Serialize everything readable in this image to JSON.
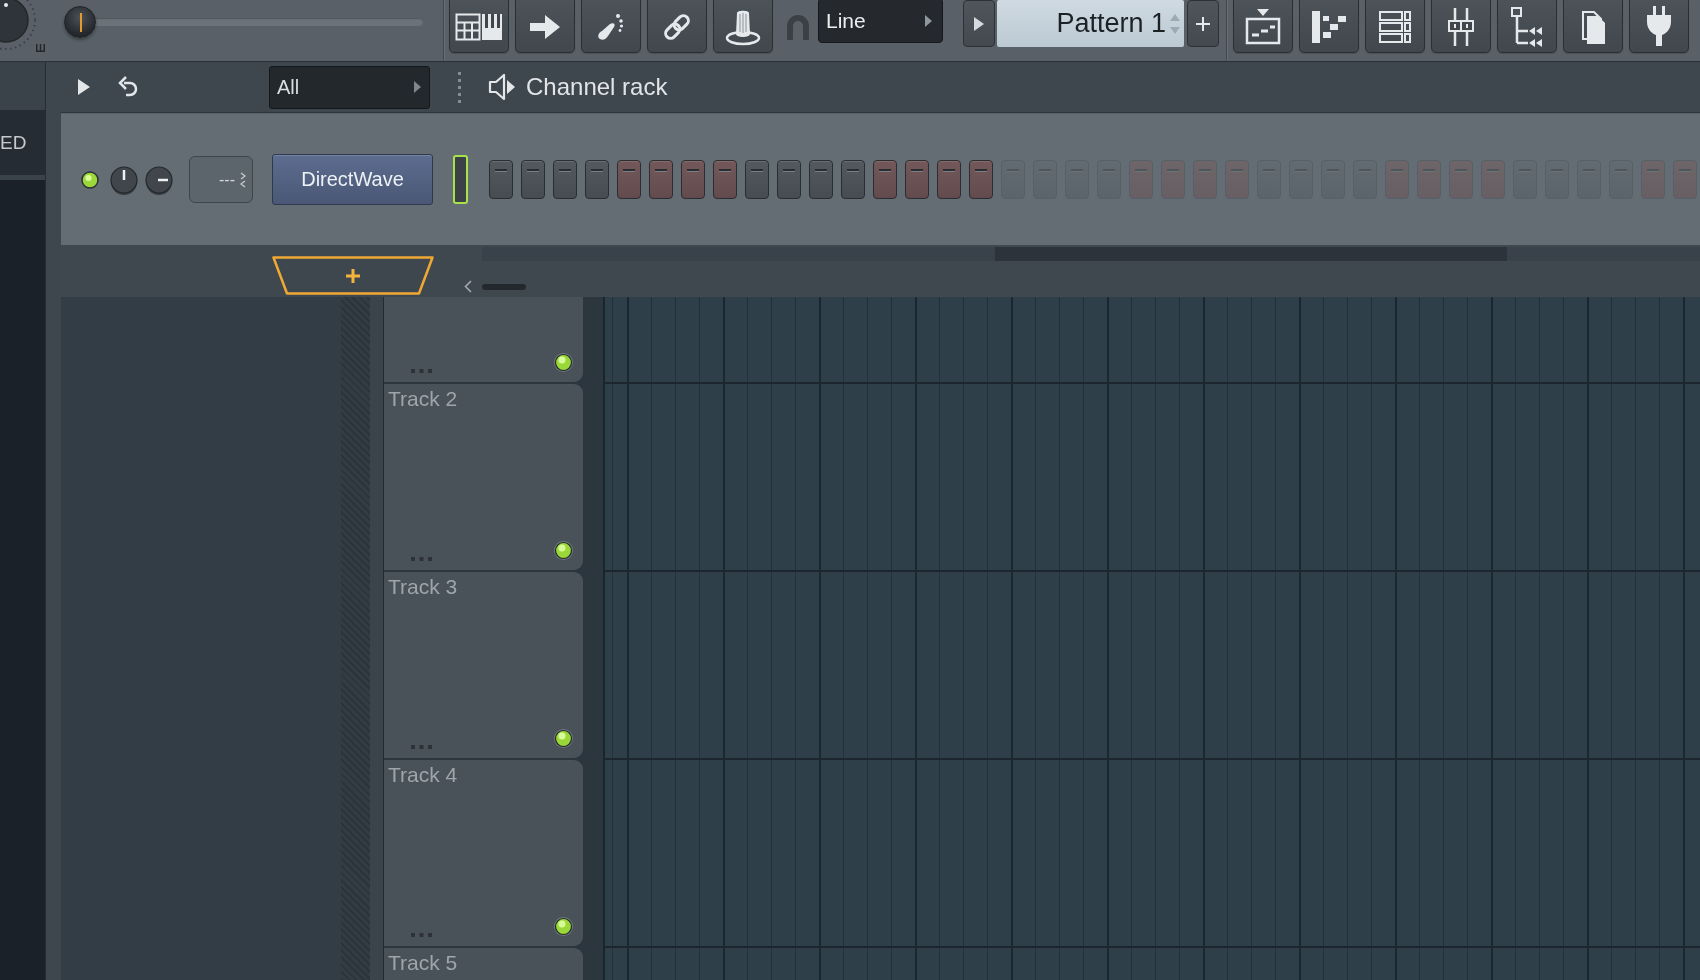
{
  "toolbar": {
    "master_slider": {
      "level": 0
    },
    "snap": {
      "value": "Line"
    },
    "pattern": {
      "value": "Pattern 1"
    }
  },
  "left_panel": {
    "label": "ED"
  },
  "channel_rack": {
    "filter": {
      "value": "All"
    },
    "title": "Channel rack",
    "channels": [
      {
        "on": true,
        "mixer_track": "---",
        "name": "DirectWave",
        "selected": true,
        "steps": [
          {
            "on": false,
            "disabled": false
          },
          {
            "on": false,
            "disabled": false
          },
          {
            "on": false,
            "disabled": false
          },
          {
            "on": false,
            "disabled": false
          },
          {
            "on": false,
            "disabled": false
          },
          {
            "on": false,
            "disabled": false
          },
          {
            "on": false,
            "disabled": false
          },
          {
            "on": false,
            "disabled": false
          },
          {
            "on": false,
            "disabled": false
          },
          {
            "on": false,
            "disabled": false
          },
          {
            "on": false,
            "disabled": false
          },
          {
            "on": false,
            "disabled": false
          },
          {
            "on": false,
            "disabled": false
          },
          {
            "on": false,
            "disabled": false
          },
          {
            "on": false,
            "disabled": false
          },
          {
            "on": false,
            "disabled": false
          },
          {
            "on": false,
            "disabled": true
          },
          {
            "on": false,
            "disabled": true
          },
          {
            "on": false,
            "disabled": true
          },
          {
            "on": false,
            "disabled": true
          },
          {
            "on": false,
            "disabled": true
          },
          {
            "on": false,
            "disabled": true
          },
          {
            "on": false,
            "disabled": true
          },
          {
            "on": false,
            "disabled": true
          },
          {
            "on": false,
            "disabled": true
          },
          {
            "on": false,
            "disabled": true
          },
          {
            "on": false,
            "disabled": true
          },
          {
            "on": false,
            "disabled": true
          },
          {
            "on": false,
            "disabled": true
          },
          {
            "on": false,
            "disabled": true
          },
          {
            "on": false,
            "disabled": true
          },
          {
            "on": false,
            "disabled": true
          },
          {
            "on": false,
            "disabled": true
          },
          {
            "on": false,
            "disabled": true
          },
          {
            "on": false,
            "disabled": true
          },
          {
            "on": false,
            "disabled": true
          },
          {
            "on": false,
            "disabled": true
          },
          {
            "on": false,
            "disabled": true
          }
        ]
      }
    ]
  },
  "playlist": {
    "tracks": [
      {
        "on": true
      },
      {
        "label": "Track 2",
        "on": true
      },
      {
        "label": "Track 3",
        "on": true
      },
      {
        "label": "Track 4",
        "on": true
      },
      {
        "label": "Track 5"
      }
    ]
  }
}
